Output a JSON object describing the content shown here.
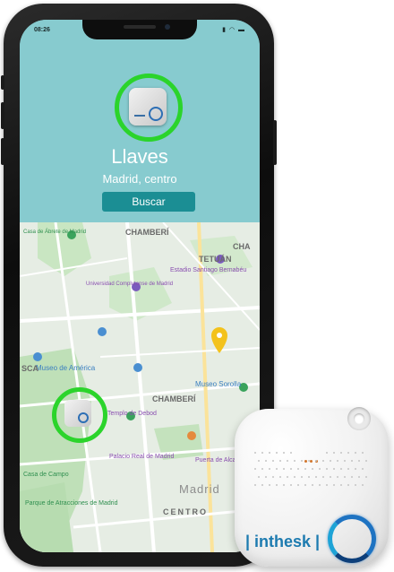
{
  "status_bar": {
    "time": "08:26",
    "icons": "▮ ◠ ▬"
  },
  "device_card": {
    "name": "Llaves",
    "location": "Madrid, centro",
    "button": "Buscar"
  },
  "map": {
    "labels": {
      "chamberi_top": "CHAMBERÍ",
      "tetuan": "TETUÁN",
      "cha": "CHA",
      "estadio": "Estadio Santiago Bernabéu",
      "caco": "Casa de Ábrete de Madrid",
      "museo": "Museo de América",
      "universidad": "Universidad Complutense de Madrid",
      "chamberi": "CHAMBERÍ",
      "sorolla": "Museo Sorolla",
      "madrid": "Madrid",
      "centro": "CENTRO",
      "parque_atracciones": "Parque de Atracciones de Madrid",
      "puerta_alcala": "Puerta de Alcalá",
      "palacio": "Palacio Real de Madrid",
      "templo": "Templo de Debod",
      "casa_campo": "Casa de Campo",
      "sca": "SCA"
    }
  },
  "product": {
    "brand": "| inthesk |"
  },
  "colors": {
    "header_bg": "#87cbcf",
    "accent_green": "#2bd42b",
    "button_bg": "#1b8e94",
    "brand_blue": "#1d7bb0"
  }
}
